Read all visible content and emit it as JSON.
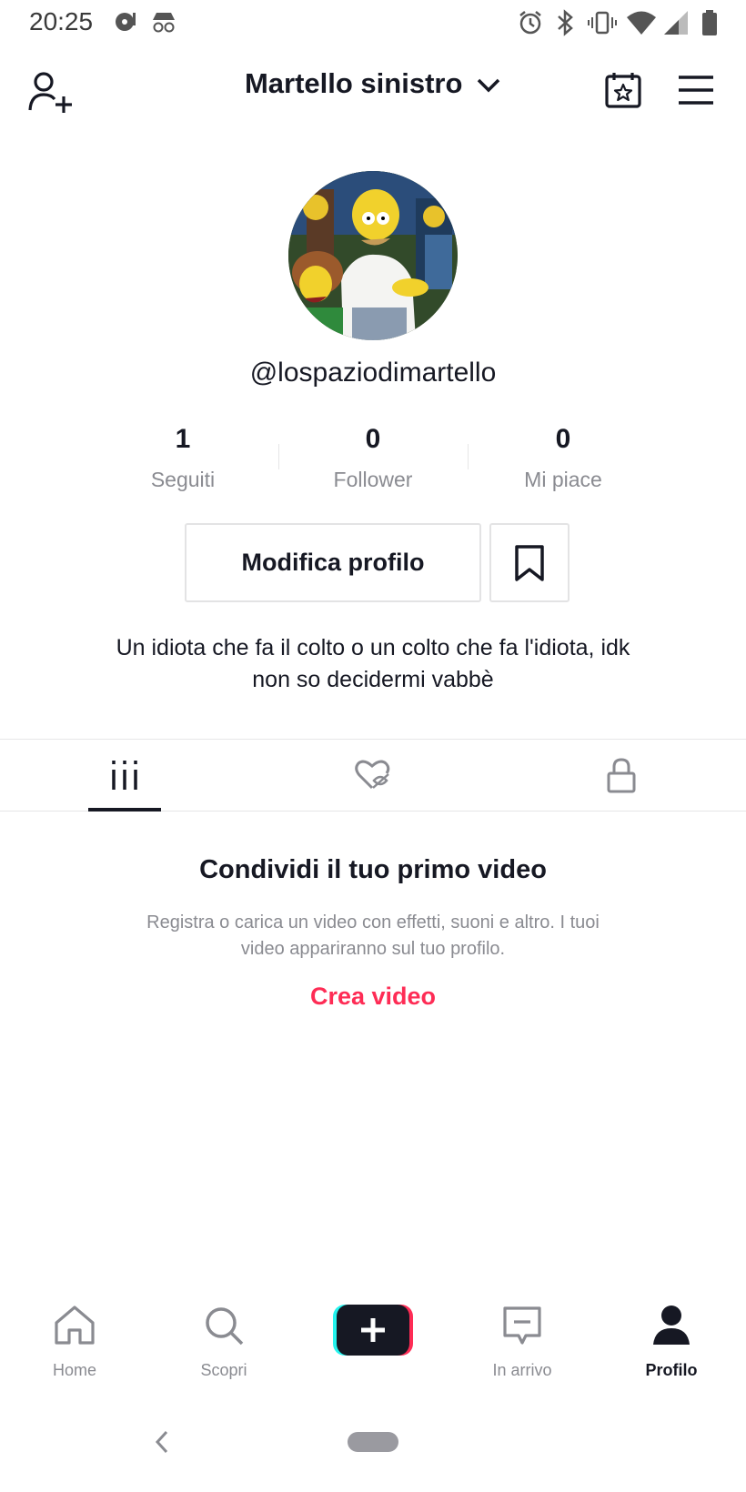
{
  "status_bar": {
    "time": "20:25",
    "left_icons": [
      "music-disc-icon",
      "incognito-icon"
    ],
    "right_icons": [
      "alarm-icon",
      "bluetooth-icon",
      "vibrate-icon",
      "wifi-icon",
      "signal-icon",
      "battery-icon"
    ]
  },
  "header": {
    "title": "Martello sinistro",
    "left_icon": "add-user-icon",
    "right_icons": [
      "calendar-star-icon",
      "menu-icon"
    ]
  },
  "profile": {
    "username": "@lospaziodimartello",
    "stats": [
      {
        "value": "1",
        "label": "Seguiti"
      },
      {
        "value": "0",
        "label": "Follower"
      },
      {
        "value": "0",
        "label": "Mi piace"
      }
    ],
    "edit_label": "Modifica profilo",
    "bio_line1": "Un idiota che fa il colto o un colto che fa l'idiota, idk",
    "bio_line2": "non so decidermi vabbè"
  },
  "tabs": [
    {
      "icon": "grid-icon",
      "active": true
    },
    {
      "icon": "liked-hidden-icon",
      "active": false
    },
    {
      "icon": "lock-icon",
      "active": false
    }
  ],
  "empty_state": {
    "title": "Condividi il tuo primo video",
    "subtitle_line1": "Registra o carica un video con effetti, suoni e altro. I tuoi",
    "subtitle_line2": "video appariranno sul tuo profilo.",
    "cta": "Crea video"
  },
  "bottom_nav": {
    "items": [
      {
        "label": "Home",
        "icon": "home-icon",
        "active": false
      },
      {
        "label": "Scopri",
        "icon": "search-icon",
        "active": false
      },
      {
        "label": "",
        "icon": "plus-icon",
        "active": false
      },
      {
        "label": "In arrivo",
        "icon": "inbox-icon",
        "active": false
      },
      {
        "label": "Profilo",
        "icon": "profile-icon",
        "active": true
      }
    ]
  },
  "colors": {
    "accent": "#fe2c55",
    "text_primary": "#161823",
    "text_secondary": "#8a8b91",
    "create_left": "#25f4ee",
    "create_right": "#fe2c55"
  }
}
